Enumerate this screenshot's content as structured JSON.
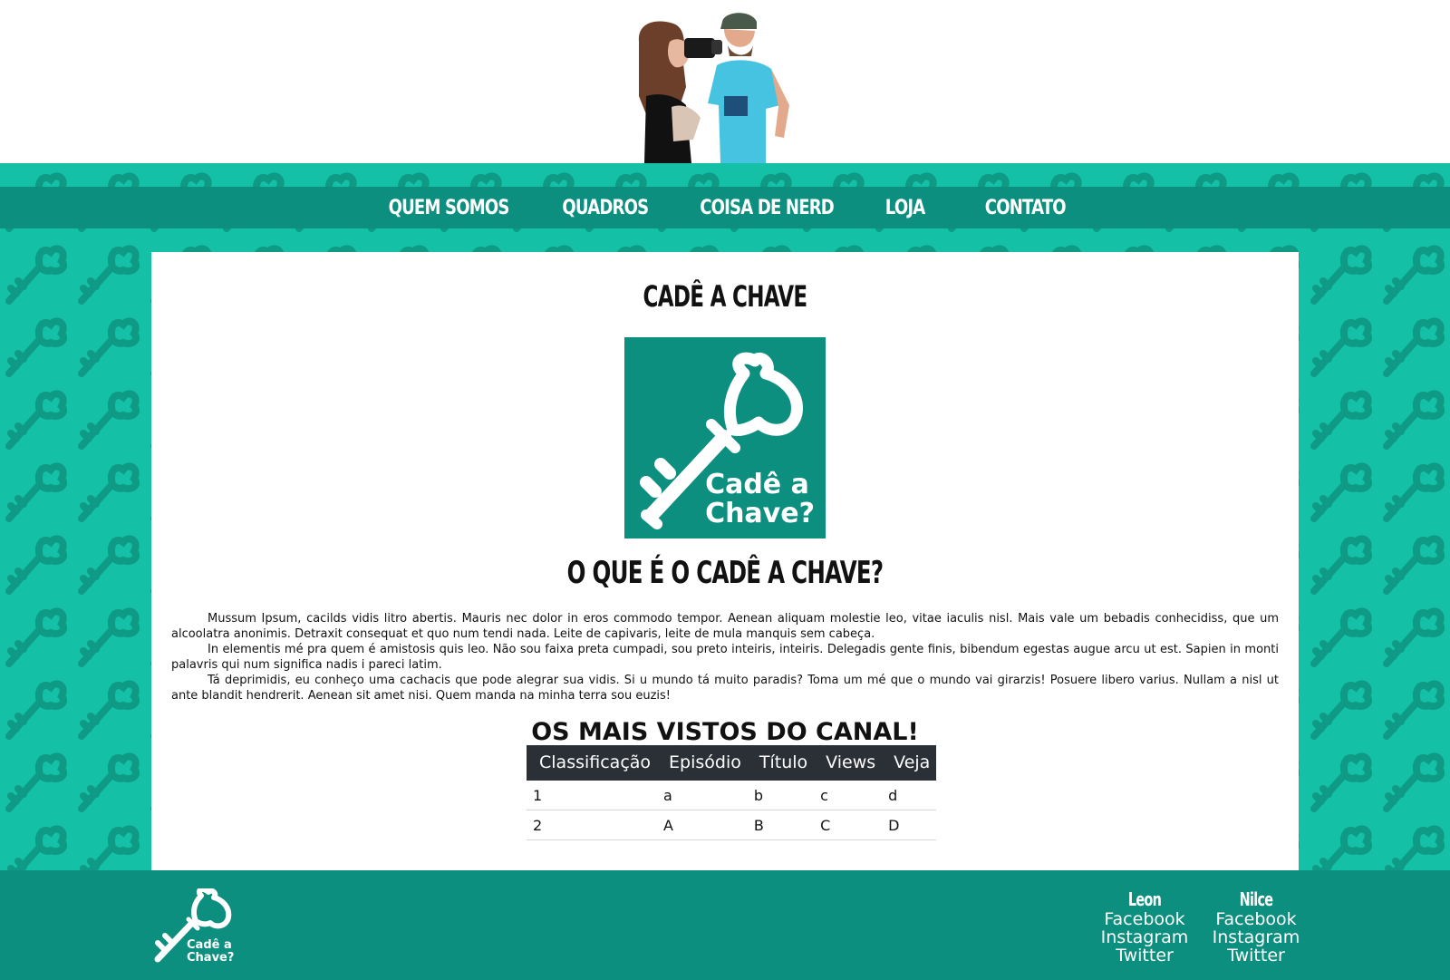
{
  "nav": {
    "items": [
      "QUEM SOMOS",
      "QUADROS",
      "COISA DE NERD",
      "LOJA",
      "CONTATO"
    ]
  },
  "main": {
    "title": "CADÊ A CHAVE",
    "logo_text_line1": "Cadê a",
    "logo_text_line2": "Chave?",
    "section_title": "O QUE É O CADÊ A CHAVE?",
    "paragraphs": [
      "Mussum Ipsum, cacilds vidis litro abertis. Mauris nec dolor in eros commodo tempor. Aenean aliquam molestie leo, vitae iaculis nisl. Mais vale um bebadis conhecidiss, que um alcoolatra anonimis. Detraxit consequat et quo num tendi nada. Leite de capivaris, leite de mula manquis sem cabeça.",
      "In elementis mé pra quem é amistosis quis leo. Não sou faixa preta cumpadi, sou preto inteiris, inteiris. Delegadis gente finis, bibendum egestas augue arcu ut est. Sapien in monti palavris qui num significa nadis i pareci latim.",
      "Tá deprimidis, eu conheço uma cachacis que pode alegrar sua vidis. Si u mundo tá muito paradis? Toma um mé que o mundo vai girarzis! Posuere libero varius. Nullam a nisl ut ante blandit hendrerit. Aenean sit amet nisi. Quem manda na minha terra sou euzis!"
    ],
    "table_title": "OS MAIS VISTOS DO CANAL!",
    "table": {
      "headers": [
        "Classificação",
        "Episódio",
        "Título",
        "Views",
        "Veja"
      ],
      "rows": [
        [
          "1",
          "a",
          "b",
          "c",
          "d"
        ],
        [
          "2",
          "A",
          "B",
          "C",
          "D"
        ]
      ]
    }
  },
  "footer": {
    "logo_text_line1": "Cadê a",
    "logo_text_line2": "Chave?",
    "columns": [
      {
        "name": "Leon",
        "links": [
          "Facebook",
          "Instagram",
          "Twitter"
        ]
      },
      {
        "name": "Nilce",
        "links": [
          "Facebook",
          "Instagram",
          "Twitter"
        ]
      }
    ]
  },
  "colors": {
    "accent_light": "#14c0a6",
    "accent_dark": "#0d8f7f",
    "table_header": "#2b2f36"
  }
}
